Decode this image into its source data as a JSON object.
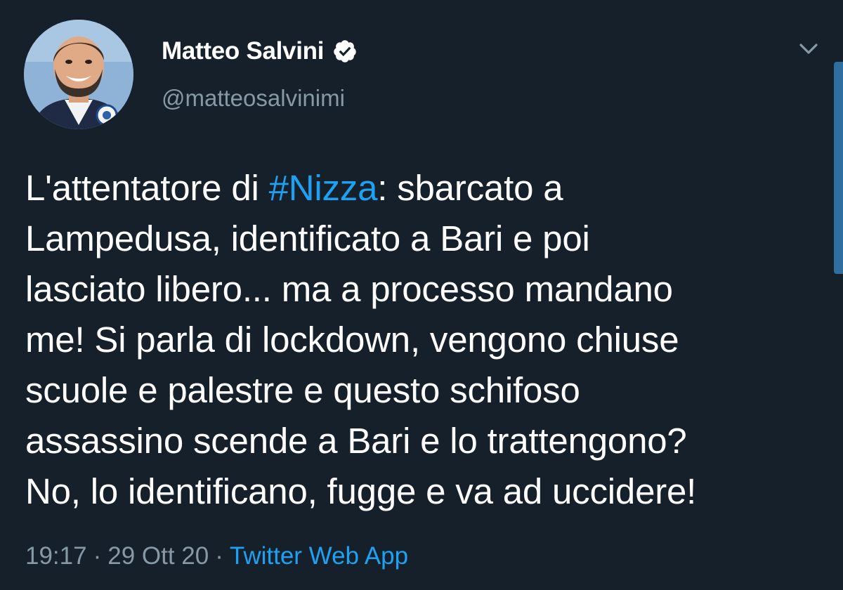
{
  "tweet": {
    "author": {
      "display_name": "Matteo Salvini",
      "handle": "@matteosalvinimi",
      "verified": true,
      "avatar_icon": "profile-photo",
      "verified_icon": "verified-badge-icon"
    },
    "menu_icon": "chevron-down-icon",
    "text": {
      "line1_before": "L'attentatore di ",
      "line1_hashtag": "#Nizza",
      "line1_after": ": sbarcato a",
      "line2": "Lampedusa, identificato a Bari e poi",
      "line3": "lasciato libero... ma a processo mandano",
      "line4": "me! Si parla di lockdown, vengono chiuse",
      "line5": "scuole e palestre e questo schifoso",
      "line6": "assassino scende a Bari e lo trattengono?",
      "line7": "No, lo identificano, fugge e va ad uccidere!"
    },
    "meta": {
      "time": "19:17",
      "separator": "·",
      "date": "29 Ott 20",
      "source": "Twitter Web App"
    }
  },
  "colors": {
    "background": "#15202b",
    "text": "#ffffff",
    "secondary_text": "#8899a6",
    "link": "#1da1f2"
  }
}
